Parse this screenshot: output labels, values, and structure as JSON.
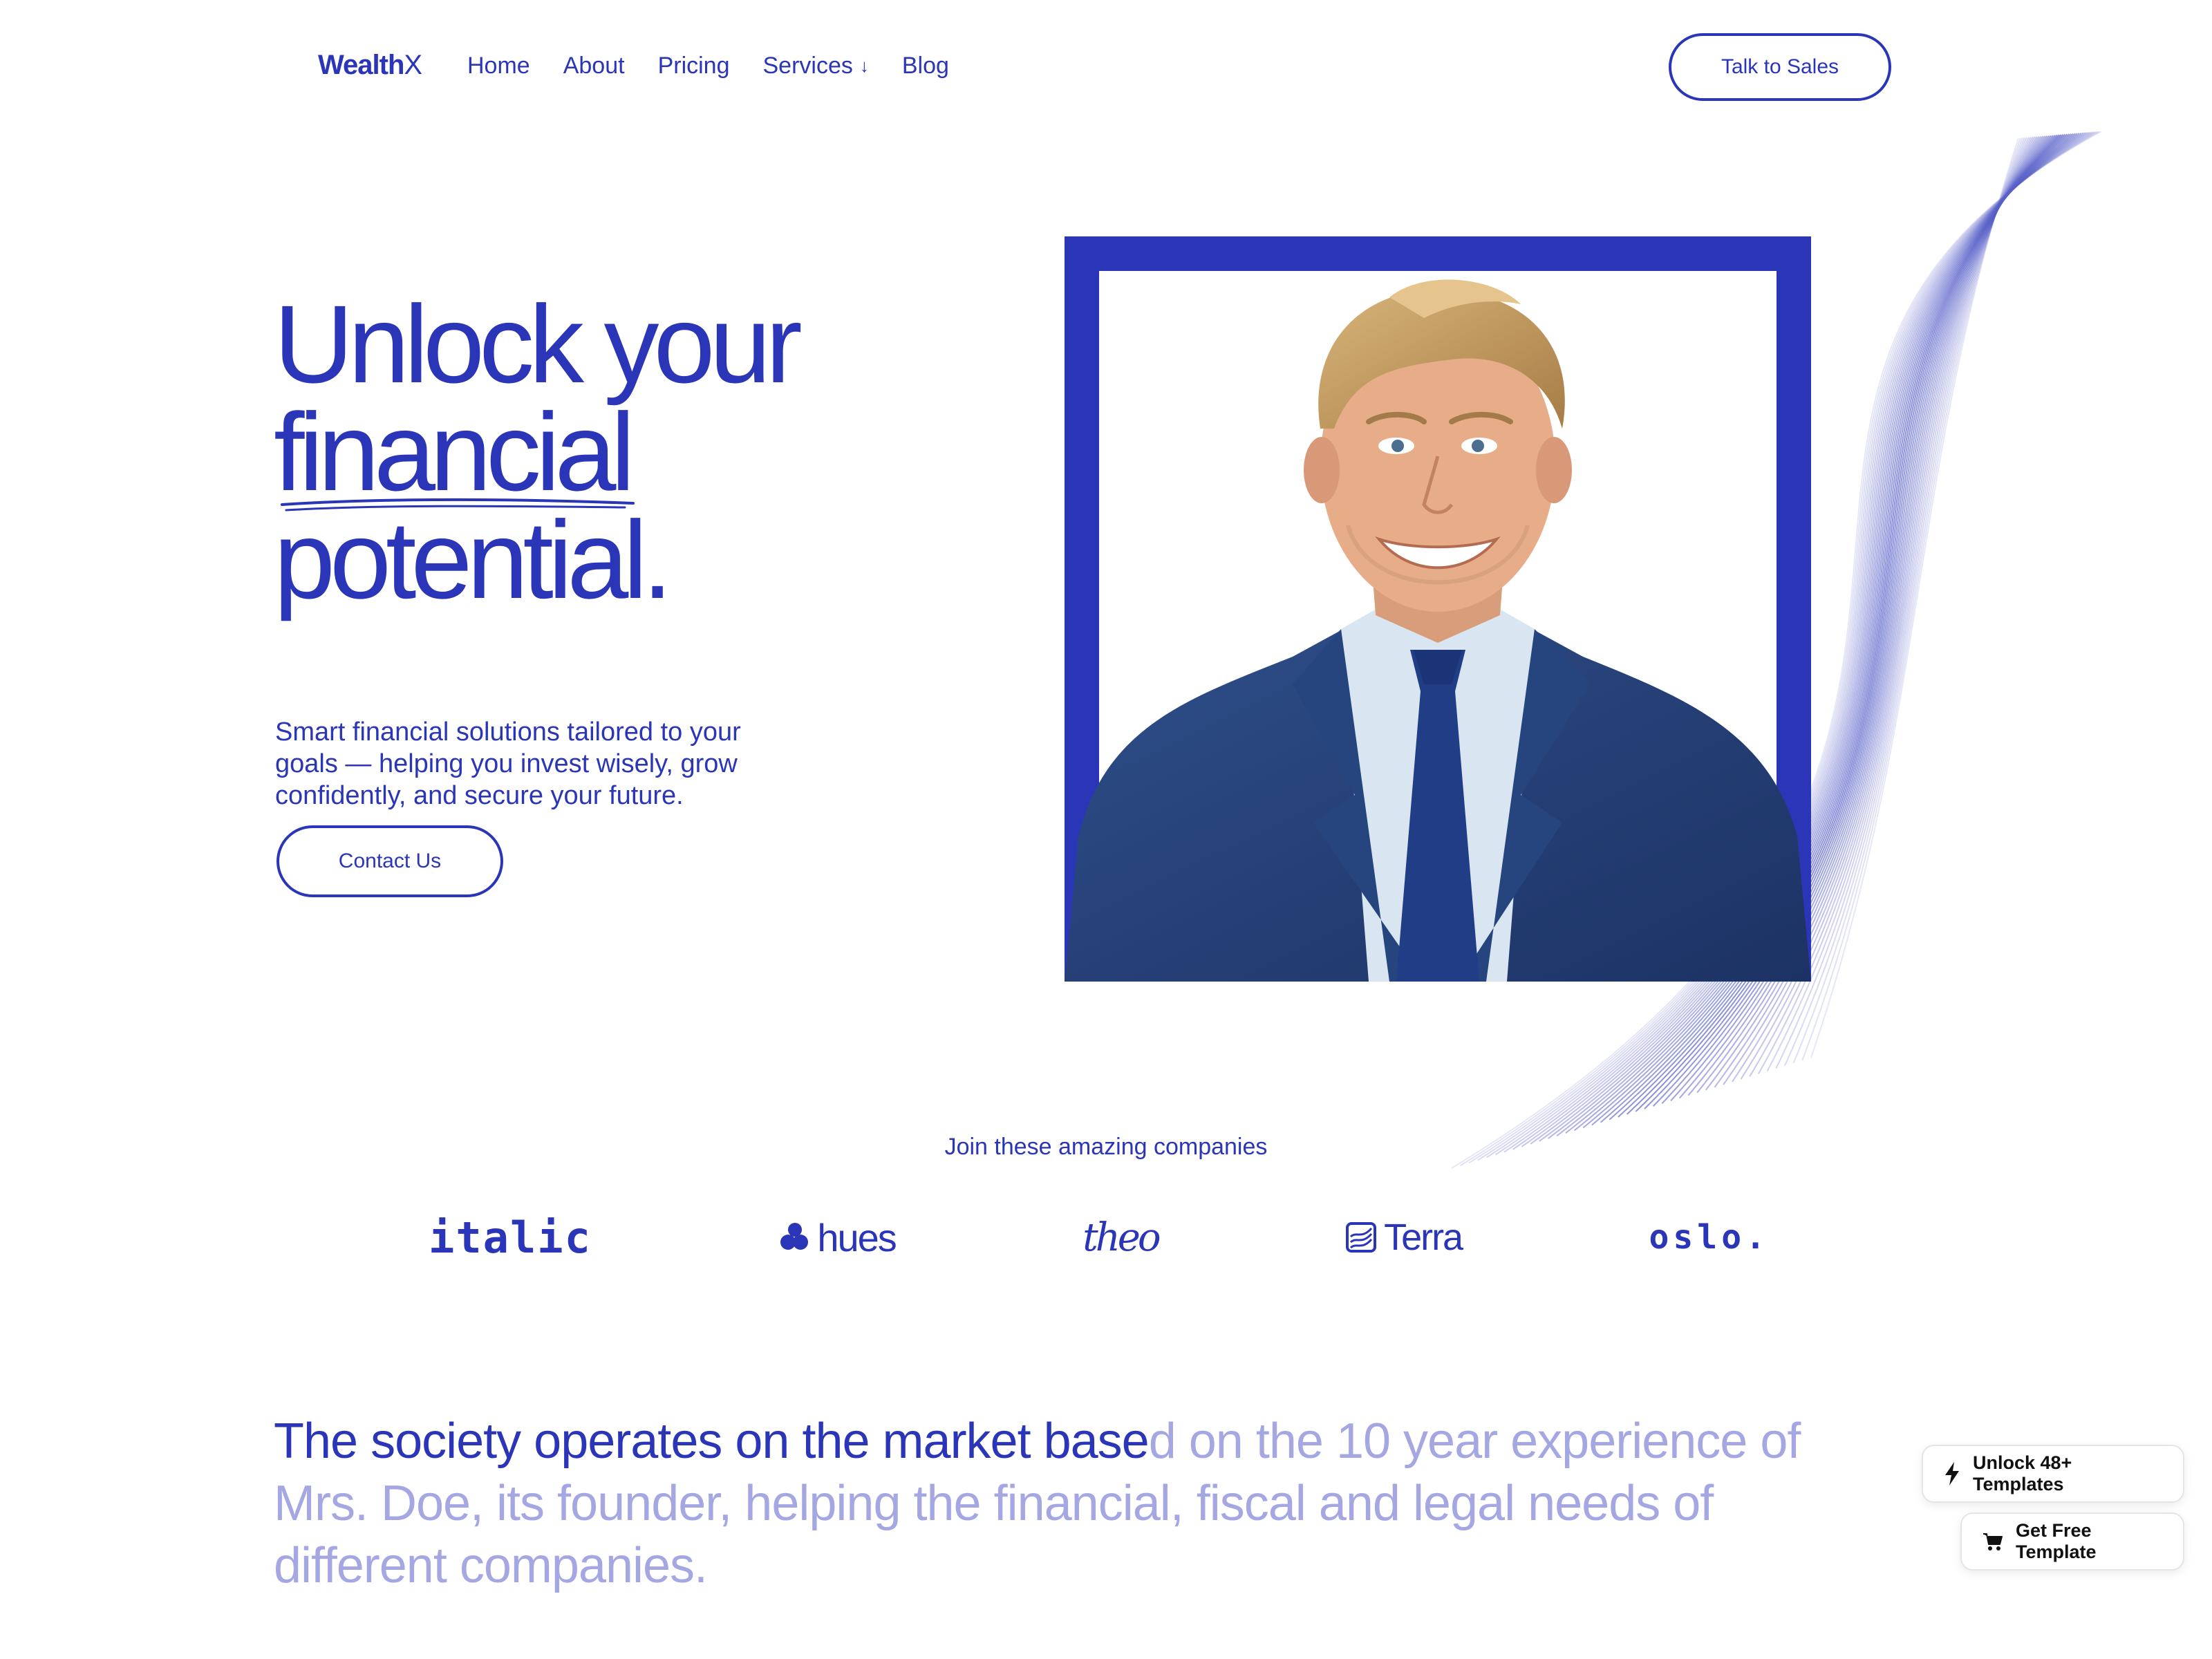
{
  "nav": {
    "logo_main": "Wealth",
    "logo_x": "X",
    "links": [
      "Home",
      "About",
      "Pricing",
      "Services",
      "Blog"
    ],
    "services_arrow": "↓",
    "cta": "Talk to Sales"
  },
  "hero": {
    "title_lines": [
      "Unlock your",
      "financial",
      "potential."
    ],
    "description": "Smart financial solutions tailored to your goals — helping you invest wisely, grow confidently, and secure your future.",
    "cta": "Contact Us",
    "image_icon": "businessman-portrait"
  },
  "companies": {
    "heading": "Join these amazing companies",
    "logos": [
      "italic",
      "hues",
      "theo",
      "Terra",
      "oslo."
    ]
  },
  "statement": {
    "highlighted": "The society operates on the market base",
    "rest": "d on the 10 year experience of Mrs. Doe, its founder, helping the financial, fiscal and legal needs of different companies."
  },
  "floating": {
    "unlock": "Unlock 48+ Templates",
    "unlock_icon": "lightning-icon",
    "free": "Get Free Template",
    "free_icon": "cart-icon"
  },
  "colors": {
    "brand": "#2b35b8",
    "faded": "#a4a7e2",
    "background": "#ffffff"
  }
}
